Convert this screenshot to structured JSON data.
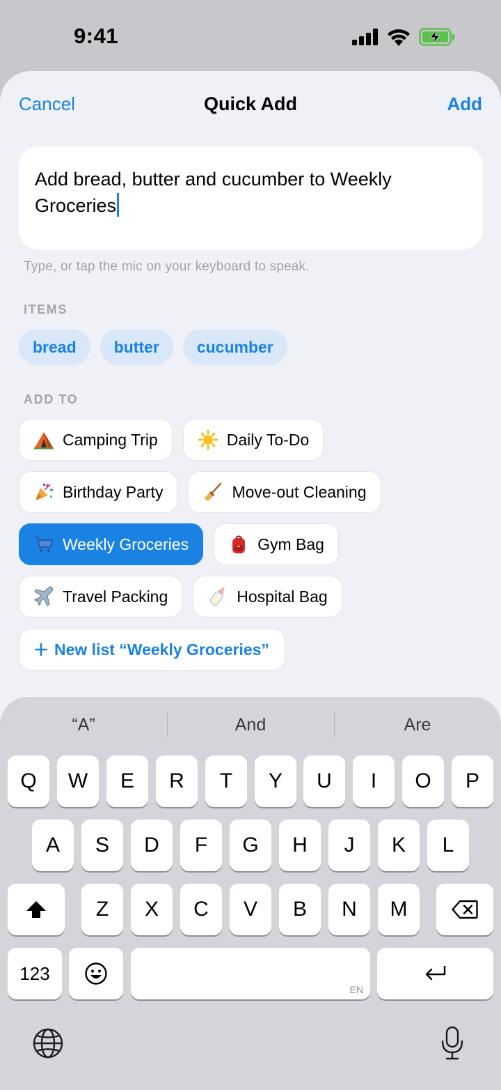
{
  "status_bar": {
    "time": "9:41"
  },
  "header": {
    "cancel_label": "Cancel",
    "title": "Quick Add",
    "add_label": "Add"
  },
  "input": {
    "line1": "Add bread, butter and cucumber to Weekly",
    "line2": "Groceries",
    "hint": "Type, or tap the mic on your keyboard to speak."
  },
  "items_section": {
    "label": "ITEMS",
    "items": [
      "bread",
      "butter",
      "cucumber"
    ]
  },
  "add_to_section": {
    "label": "ADD TO",
    "lists": [
      {
        "emoji": "tent-icon",
        "label": "Camping Trip",
        "selected": false
      },
      {
        "emoji": "sun-icon",
        "label": "Daily To-Do",
        "selected": false
      },
      {
        "emoji": "party-popper-icon",
        "label": "Birthday Party",
        "selected": false
      },
      {
        "emoji": "broom-icon",
        "label": "Move-out Cleaning",
        "selected": false
      },
      {
        "emoji": "shopping-cart-icon",
        "label": "Weekly Groceries",
        "selected": true
      },
      {
        "emoji": "backpack-icon",
        "label": "Gym Bag",
        "selected": false
      },
      {
        "emoji": "airplane-icon",
        "label": "Travel Packing",
        "selected": false
      },
      {
        "emoji": "baby-bottle-icon",
        "label": "Hospital Bag",
        "selected": false
      }
    ],
    "new_list_label": "New list “Weekly Groceries”"
  },
  "keyboard": {
    "suggestions": [
      "“A”",
      "And",
      "Are"
    ],
    "row1": [
      "Q",
      "W",
      "E",
      "R",
      "T",
      "Y",
      "U",
      "I",
      "O",
      "P"
    ],
    "row2": [
      "A",
      "S",
      "D",
      "F",
      "G",
      "H",
      "J",
      "K",
      "L"
    ],
    "row3": [
      "Z",
      "X",
      "C",
      "V",
      "B",
      "N",
      "M"
    ],
    "numbers_label": "123",
    "language_tag": "EN"
  },
  "colors": {
    "accent": "#1a82e2",
    "sheet_bg": "#f0f1f6",
    "keyboard_bg": "#d3d5db"
  }
}
